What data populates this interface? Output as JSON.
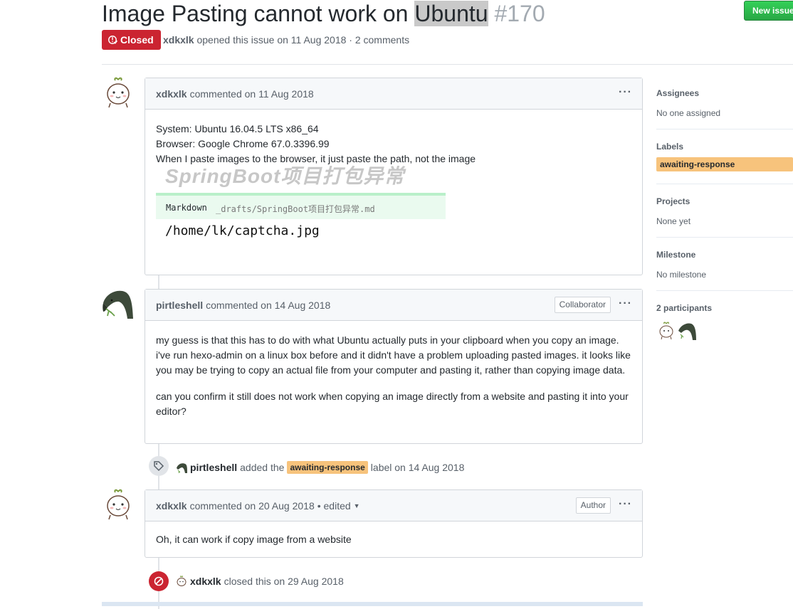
{
  "header": {
    "title_prefix": "Image Pasting cannot work on ",
    "title_highlight": "Ubuntu",
    "issue_number": "#170",
    "new_issue_label": "New issue",
    "state_label": "Closed",
    "author": "xdkxlk",
    "meta_text": "opened this issue on 11 Aug 2018 · 2 comments"
  },
  "comments": [
    {
      "author": "xdkxlk",
      "action": "commented on 11 Aug 2018",
      "lines": [
        "System: Ubuntu 16.04.5 LTS x86_64",
        "Browser: Google Chrome 67.0.3396.99",
        "When I paste images to the browser, it just paste the path, not the image"
      ],
      "watermark": "SpringBoot项目打包异常",
      "markdown_label": "Markdown",
      "markdown_path": "_drafts/SpringBoot项目打包异常.md",
      "code_path": "/home/lk/captcha.jpg"
    },
    {
      "author": "pirtleshell",
      "action": "commented on 14 Aug 2018",
      "role": "Collaborator",
      "paragraphs": [
        "my guess is that this has to do with what Ubuntu actually puts in your clipboard when you copy an image. i've run hexo-admin on a linux box before and it didn't have a problem uploading pasted images. it looks like you may be trying to copy an actual file from your computer and pasting it, rather than copying image data.",
        "can you confirm it still does not work when copying an image directly from a website and pasting it into your editor?"
      ]
    },
    {
      "author": "xdkxlk",
      "action": "commented on 20 Aug 2018",
      "edited": "• edited",
      "role": "Author",
      "paragraphs": [
        "Oh, it can work if copy image from a website"
      ]
    }
  ],
  "events": {
    "label_event": {
      "actor": "pirtleshell",
      "pre": "added the",
      "label": "awaiting-response",
      "post": "label on 14 Aug 2018"
    },
    "close_event": {
      "actor": "xdkxlk",
      "text": "closed this on 29 Aug 2018"
    }
  },
  "sidebar": {
    "assignees": {
      "title": "Assignees",
      "value": "No one assigned"
    },
    "labels": {
      "title": "Labels",
      "value": "awaiting-response"
    },
    "projects": {
      "title": "Projects",
      "value": "None yet"
    },
    "milestone": {
      "title": "Milestone",
      "value": "No milestone"
    },
    "participants": {
      "title": "2 participants"
    }
  },
  "icons": {
    "state": "issue-closed-icon",
    "kebab": "kebab-horizontal-icon",
    "tag": "tag-icon",
    "circle_slash": "circle-slash-icon",
    "caret": "triangle-down-icon"
  },
  "colors": {
    "closed_red": "#cb2431",
    "new_issue_green": "#28a745",
    "label_orange": "#f7c37c",
    "md_bar_green": "#eafaef"
  }
}
